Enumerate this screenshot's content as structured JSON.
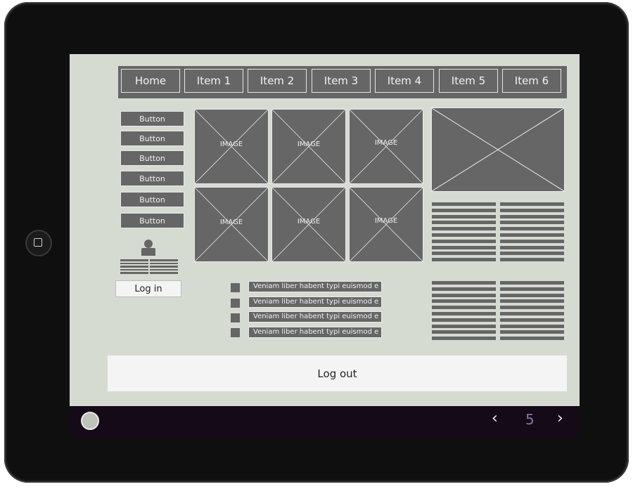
{
  "nav": {
    "items": [
      "Home",
      "Item 1",
      "Item 2",
      "Item 3",
      "Item 4",
      "Item 5",
      "Item 6"
    ]
  },
  "sidebar": {
    "buttons": [
      "Button",
      "Button",
      "Button",
      "Button",
      "Button",
      "Button"
    ]
  },
  "login": {
    "label": "Log in"
  },
  "gallery": {
    "image_label": "IMAGE"
  },
  "list": {
    "items": [
      "Veniam liber habent typi euismod e",
      "Veniam liber habent typi euismod e",
      "Veniam liber habent typi euismod e",
      "Veniam liber habent typi euismod e"
    ]
  },
  "logout": {
    "label": "Log out"
  },
  "pagination": {
    "prev": "‹",
    "page": "5",
    "next": "›"
  },
  "icons": {
    "home": "home-square-icon",
    "circle": "circle-icon"
  },
  "colors": {
    "screen": "#d6dbd2",
    "wire": "#666666",
    "bar": "#150a17",
    "page_accent": "#8e72a8"
  }
}
